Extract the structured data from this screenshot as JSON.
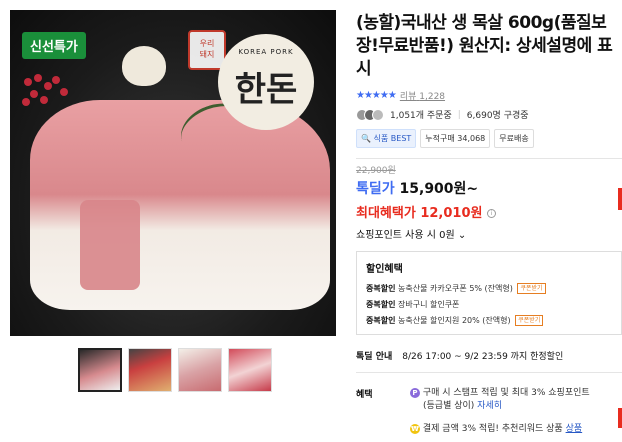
{
  "image": {
    "badge_fresh": "신선특가",
    "seal": "우리\n돼지",
    "logo_top": "KOREA PORK",
    "logo_main": "한돈"
  },
  "product": {
    "title": "(농할)국내산 생 목살 600g(품질보장!무료반품!) 원산지: 상세설명에 표시",
    "stars": "★★★★★",
    "review_label": "리뷰",
    "review_count": "1,228",
    "orders": "1,051개 주문중",
    "subscribers": "6,690명 구경중"
  },
  "tags": [
    "식품 BEST",
    "누적구매 34,068",
    "무료배송"
  ],
  "price": {
    "original": "22,900원",
    "sale_label": "톡딜가",
    "sale_price": "15,900원~",
    "max_label": "최대혜택가",
    "max_price": "12,010원",
    "points_text": "쇼핑포인트 사용 시 0원",
    "points_arrow": "⌄"
  },
  "discount": {
    "heading": "할인혜택",
    "lines": [
      {
        "title": "중복할인",
        "text": "농축산물 카카오쿠폰 5% (잔액형)",
        "btn": "쿠폰받기"
      },
      {
        "title": "중복할인",
        "text": "장바구니 할인쿠폰",
        "btn": ""
      },
      {
        "title": "중복할인",
        "text": "농축산물 할인지원 20% (잔액형)",
        "btn": "쿠폰받기"
      }
    ]
  },
  "special": {
    "label": "톡딜 안내",
    "text": "8/26 17:00 ~ 9/2 23:59 까지 한정할인"
  },
  "benefit": {
    "label": "혜택",
    "line1": "구매 시 스탬프 적립 및 최대 3% 쇼핑포인트",
    "line1_b": "(등급별 상이)",
    "line1_link": "자세히",
    "line2": "결제 금액 3% 적립! 추천리워드 상품",
    "line2_link": "상품"
  },
  "colors": {
    "accent_blue": "#3f6cf2",
    "red": "#e82c1f",
    "green_badge": "#1a8f3a"
  }
}
